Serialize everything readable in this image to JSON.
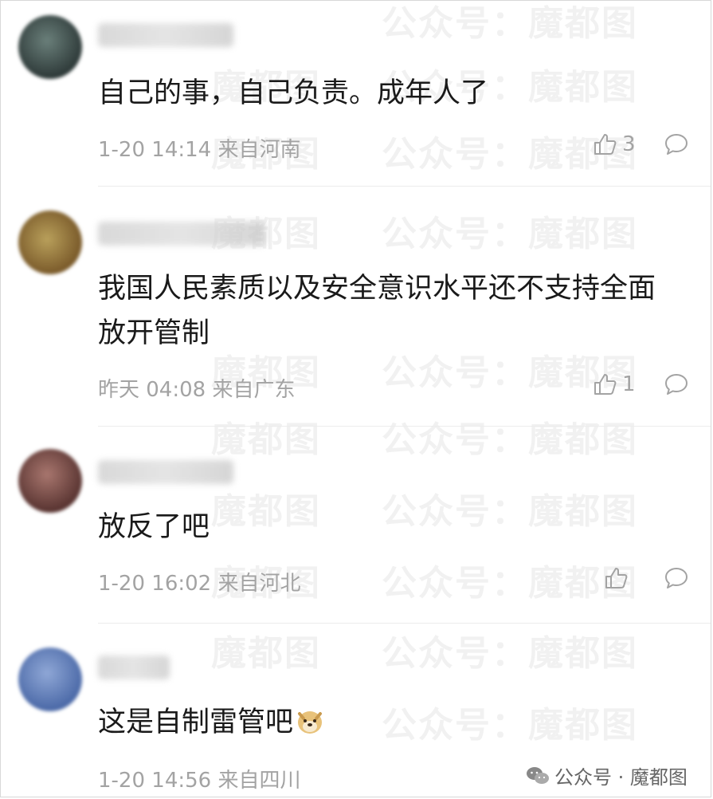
{
  "watermark": {
    "text_left": "公众号：",
    "text_right": "魔都图"
  },
  "comments": [
    {
      "text": "自己的事，自己负责。成年人了",
      "time": "1-20 14:14",
      "location": "来自河南",
      "likes": "3"
    },
    {
      "text": "我国人民素质以及安全意识水平还不支持全面放开管制",
      "time": "昨天 04:08",
      "location": "来自广东",
      "likes": "1"
    },
    {
      "text": "放反了吧",
      "time": "1-20 16:02",
      "location": "来自河北",
      "likes": ""
    },
    {
      "text": "这是自制雷管吧",
      "time": "1-20 14:56",
      "location": "来自四川",
      "likes": ""
    }
  ],
  "footer": {
    "brand": "公众号 · 魔都图"
  },
  "colors": {
    "text": "#1a1a1a",
    "meta": "#a3a3a3",
    "divider": "#ececec"
  }
}
